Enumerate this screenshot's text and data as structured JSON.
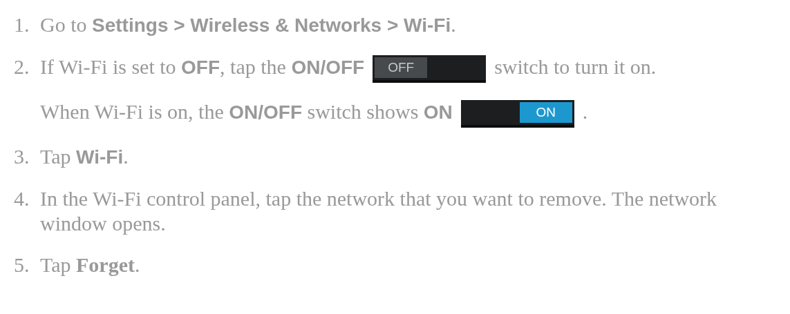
{
  "steps": [
    {
      "number": "1.",
      "paragraphs": [
        [
          {
            "kind": "text",
            "text": "Go to "
          },
          {
            "kind": "ui",
            "text": "Settings > Wireless & Networks > Wi-Fi"
          },
          {
            "kind": "text",
            "text": "."
          }
        ]
      ]
    },
    {
      "number": "2.",
      "paragraphs": [
        [
          {
            "kind": "text",
            "text": "If Wi-Fi is set to "
          },
          {
            "kind": "ui",
            "text": "OFF"
          },
          {
            "kind": "text",
            "text": ", tap the "
          },
          {
            "kind": "ui",
            "text": "ON/OFF"
          },
          {
            "kind": "switch",
            "label": "OFF",
            "on": false
          },
          {
            "kind": "text",
            "text": "switch to turn it on."
          }
        ],
        [
          {
            "kind": "text",
            "text": "When Wi-Fi is on, the "
          },
          {
            "kind": "ui",
            "text": "ON/OFF"
          },
          {
            "kind": "text",
            "text": " switch shows "
          },
          {
            "kind": "ui",
            "text": "ON"
          },
          {
            "kind": "switch",
            "label": "ON",
            "on": true
          },
          {
            "kind": "text",
            "text": "."
          }
        ]
      ]
    },
    {
      "number": "3.",
      "paragraphs": [
        [
          {
            "kind": "text",
            "text": "Tap "
          },
          {
            "kind": "ui",
            "text": "Wi-Fi"
          },
          {
            "kind": "text",
            "text": "."
          }
        ]
      ]
    },
    {
      "number": "4.",
      "paragraphs": [
        [
          {
            "kind": "text",
            "text": "In the Wi-Fi control panel, tap the network that you want to remove. The network window opens."
          }
        ]
      ]
    },
    {
      "number": "5.",
      "paragraphs": [
        [
          {
            "kind": "text",
            "text": "Tap **Forget**."
          }
        ]
      ]
    }
  ]
}
